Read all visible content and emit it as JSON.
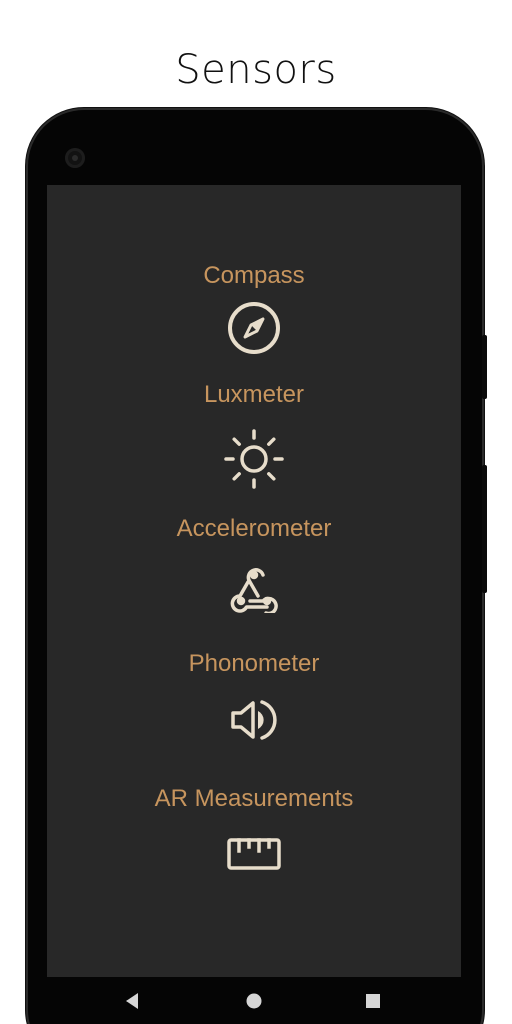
{
  "page": {
    "title": "Sensors"
  },
  "sensors": [
    {
      "label": "Compass",
      "icon": "compass-icon"
    },
    {
      "label": "Luxmeter",
      "icon": "sun-icon"
    },
    {
      "label": "Accelerometer",
      "icon": "webhook-icon"
    },
    {
      "label": "Phonometer",
      "icon": "speaker-icon"
    },
    {
      "label": "AR Measurements",
      "icon": "ruler-icon"
    }
  ],
  "navigation": {
    "buttons": [
      "back-icon",
      "home-icon",
      "recents-icon"
    ]
  },
  "colors": {
    "accent": "#c7955e",
    "icon": "#e7ddcb",
    "screen_background": "#282828",
    "frame": "#050505"
  }
}
